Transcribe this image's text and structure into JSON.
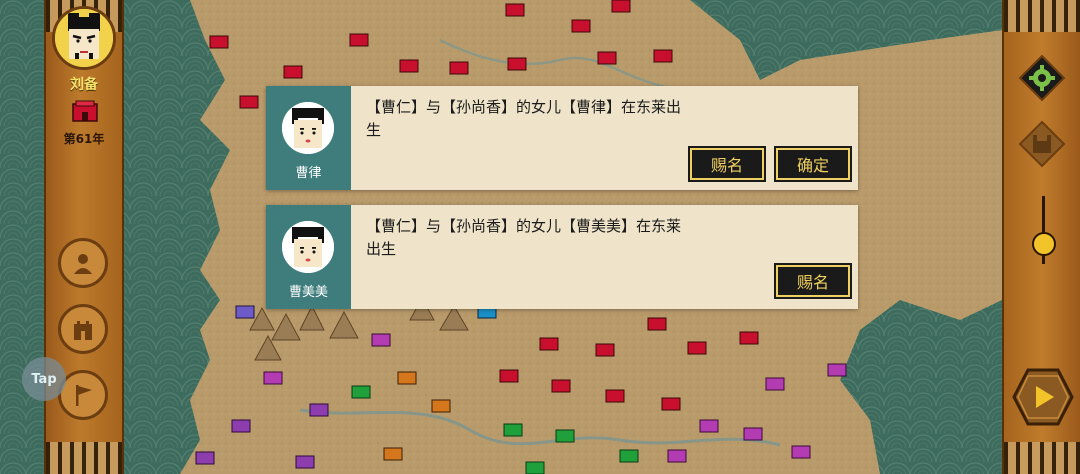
{
  "player": {
    "name": "刘备",
    "year": "第61年"
  },
  "notifications": [
    {
      "child_name": "曹律",
      "message": "【曹仁】与【孙尚香】的女儿【曹律】在东莱出生",
      "name_button": "赐名",
      "ok_button": "确定"
    },
    {
      "child_name": "曹美美",
      "message": "【曹仁】与【孙尚香】的女儿【曹美美】在东莱出生",
      "name_button": "赐名"
    }
  ],
  "tap_badge": "Tap",
  "colors": {
    "sea": "#3c6a5c",
    "land": "#b89a6a",
    "panel": "#b37026",
    "dialog": "#efe3c9",
    "avatar_pane": "#3f7d7d",
    "button_text": "#f0d060",
    "red_faction": "#c8102e",
    "purple_faction": "#8e3dae",
    "green_faction": "#1fa03a",
    "orange_faction": "#d4761c"
  },
  "icons": {
    "settings": "gear-icon",
    "save": "save-icon",
    "play": "play-icon",
    "people": "person-icon",
    "castle": "castle-icon",
    "flag": "flag-icon"
  }
}
